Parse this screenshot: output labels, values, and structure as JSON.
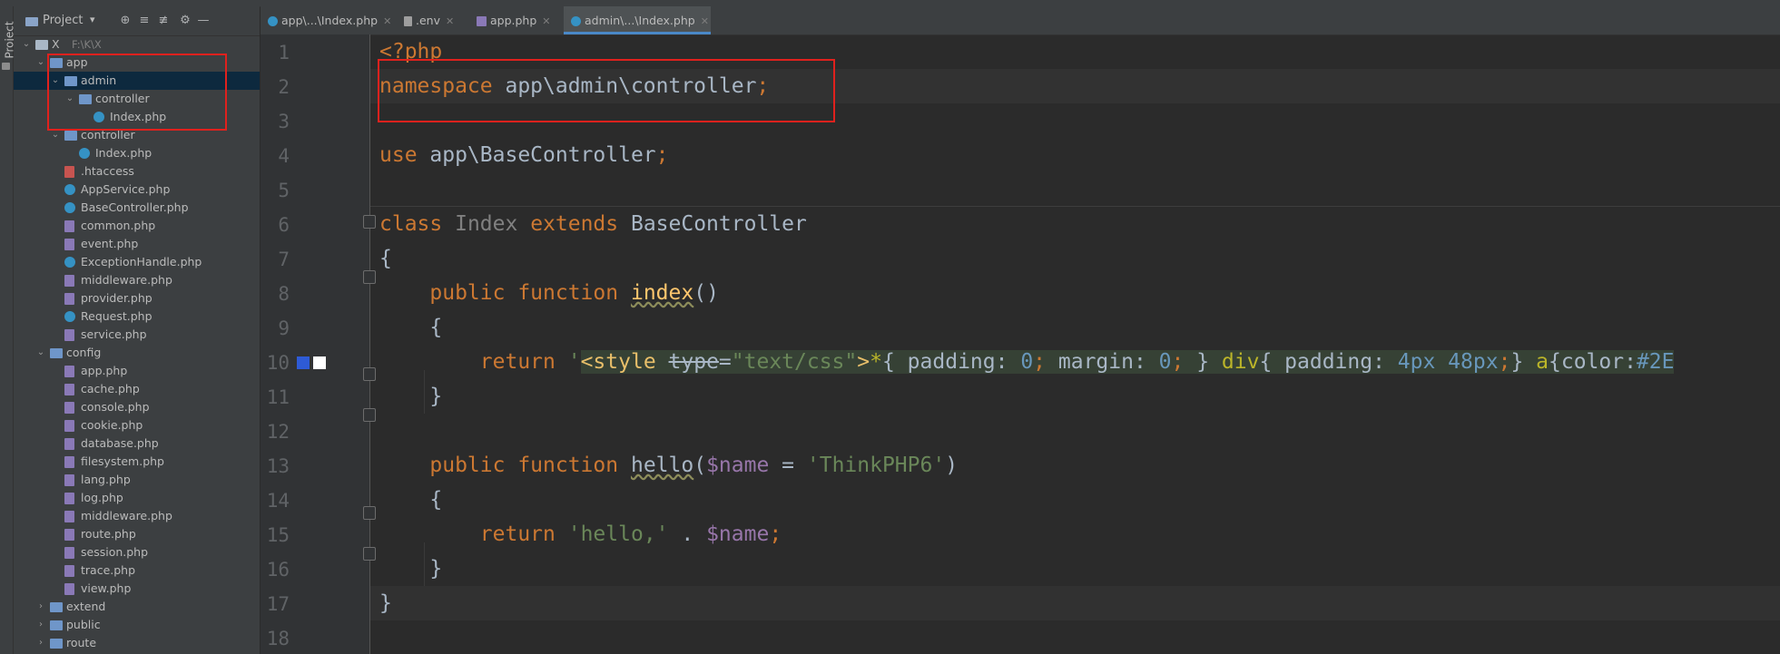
{
  "stripe": {
    "label": "Project"
  },
  "panel": {
    "title": "Project",
    "tree": [
      {
        "label": "X",
        "path": "F:\\K\\X",
        "icon": "project-folder-icon"
      },
      {
        "label": "app",
        "icon": "folder-icon"
      },
      {
        "label": "admin",
        "icon": "folder-icon"
      },
      {
        "label": "controller",
        "icon": "folder-icon"
      },
      {
        "label": "Index.php",
        "icon": "php-class-icon"
      },
      {
        "label": "controller",
        "icon": "folder-icon"
      },
      {
        "label": "Index.php",
        "icon": "php-class-icon"
      },
      {
        "label": ".htaccess",
        "icon": "htaccess-icon"
      },
      {
        "label": "AppService.php",
        "icon": "php-class-icon"
      },
      {
        "label": "BaseController.php",
        "icon": "php-abstract-class-icon"
      },
      {
        "label": "common.php",
        "icon": "php-file-icon"
      },
      {
        "label": "event.php",
        "icon": "php-file-icon"
      },
      {
        "label": "ExceptionHandle.php",
        "icon": "php-class-icon"
      },
      {
        "label": "middleware.php",
        "icon": "php-file-icon"
      },
      {
        "label": "provider.php",
        "icon": "php-file-icon"
      },
      {
        "label": "Request.php",
        "icon": "php-class-icon"
      },
      {
        "label": "service.php",
        "icon": "php-file-icon"
      },
      {
        "label": "config",
        "icon": "folder-icon"
      },
      {
        "label": "app.php",
        "icon": "php-file-icon"
      },
      {
        "label": "cache.php",
        "icon": "php-file-icon"
      },
      {
        "label": "console.php",
        "icon": "php-file-icon"
      },
      {
        "label": "cookie.php",
        "icon": "php-file-icon"
      },
      {
        "label": "database.php",
        "icon": "php-file-icon"
      },
      {
        "label": "filesystem.php",
        "icon": "php-file-icon"
      },
      {
        "label": "lang.php",
        "icon": "php-file-icon"
      },
      {
        "label": "log.php",
        "icon": "php-file-icon"
      },
      {
        "label": "middleware.php",
        "icon": "php-file-icon"
      },
      {
        "label": "route.php",
        "icon": "php-file-icon"
      },
      {
        "label": "session.php",
        "icon": "php-file-icon"
      },
      {
        "label": "trace.php",
        "icon": "php-file-icon"
      },
      {
        "label": "view.php",
        "icon": "php-file-icon"
      },
      {
        "label": "extend",
        "icon": "folder-icon"
      },
      {
        "label": "public",
        "icon": "folder-icon"
      },
      {
        "label": "route",
        "icon": "folder-icon"
      }
    ]
  },
  "tabs": [
    {
      "label": "app\\...\\Index.php",
      "active": false
    },
    {
      "label": ".env",
      "active": false
    },
    {
      "label": "app.php",
      "active": false
    },
    {
      "label": "admin\\...\\Index.php",
      "active": true
    }
  ],
  "editor": {
    "line_numbers": [
      "1",
      "2",
      "3",
      "4",
      "5",
      "6",
      "7",
      "8",
      "9",
      "10",
      "11",
      "12",
      "13",
      "14",
      "15",
      "16",
      "17",
      "18"
    ],
    "code": {
      "l1_open": "<?php",
      "l2_kw": "namespace",
      "l2_ns": " app\\admin\\controller",
      "l2_semi": ";",
      "l4_kw": "use",
      "l4_name": " app\\BaseController",
      "l4_semi": ";",
      "l6_class": "class",
      "l6_name": " Index",
      "l6_extends": " extends",
      "l6_base": " BaseController",
      "l7": "{",
      "l8_indent": "    ",
      "l8_kw": "public function",
      "l8_sp": " ",
      "l8_fn": "index",
      "l8_paren": "()",
      "l9": "    {",
      "l10_indent": "        ",
      "l10_kw": "return",
      "l10_q": " '",
      "l10_tag": "<style",
      "l10_sp": " ",
      "l10_attr": "type",
      "l10_eq": "=",
      "l10_attrval": "\"text/css\"",
      "l10_close": ">",
      "l10_star": "*",
      "l10_b1": "{ padding: ",
      "l10_z1": "0",
      "l10_s1": ";",
      "l10_m": " margin: ",
      "l10_z2": "0",
      "l10_s2": ";",
      "l10_b2": " } ",
      "l10_div": "div",
      "l10_b3": "{ padding: ",
      "l10_px": "4px 48px",
      "l10_s3": ";",
      "l10_b4": "} ",
      "l10_a": "a",
      "l10_b5": "{color:",
      "l10_col": "#2E",
      "l11": "    }",
      "l13_indent": "    ",
      "l13_kw": "public function",
      "l13_sp": " ",
      "l13_fn": "hello",
      "l13_p1": "(",
      "l13_var": "$name",
      "l13_eq": " = ",
      "l13_str": "'ThinkPHP6'",
      "l13_p2": ")",
      "l14": "    {",
      "l15_indent": "        ",
      "l15_kw": "return",
      "l15_sp": " ",
      "l15_str": "'hello,'",
      "l15_dot": " . ",
      "l15_var": "$name",
      "l15_semi": ";",
      "l16": "    }",
      "l17": "}"
    },
    "swatch_colors": [
      "#2e5bd6",
      "#ffffff"
    ]
  }
}
